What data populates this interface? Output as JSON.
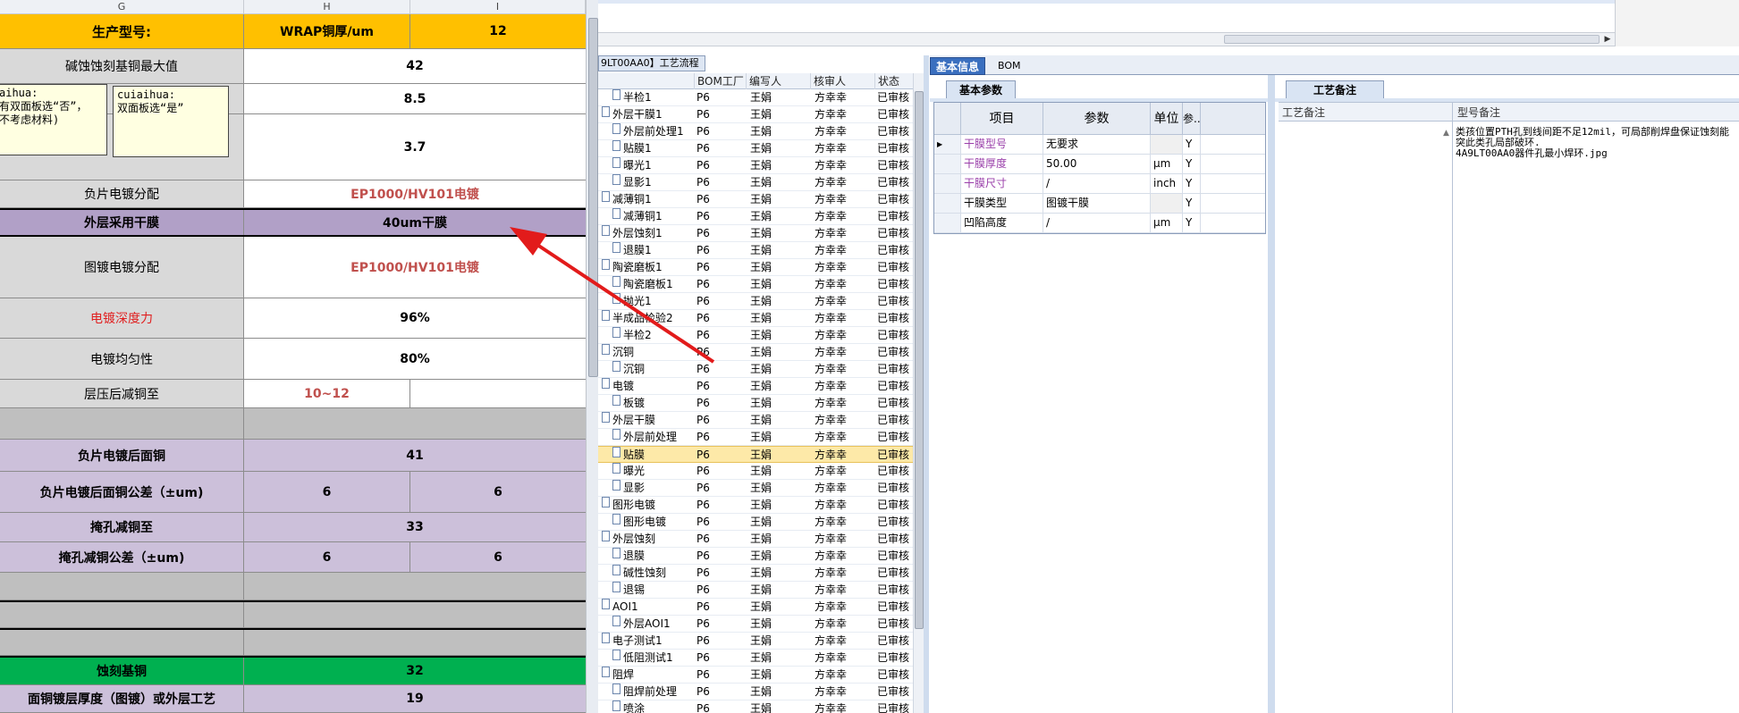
{
  "sheet": {
    "columns": [
      "G",
      "H",
      "I"
    ],
    "rows": [
      {
        "label": "生产型号:",
        "h": "WRAP铜厚/um",
        "i": "12"
      },
      {
        "label": "碱蚀蚀刻基铜最大值",
        "value": "42"
      },
      {
        "label": "",
        "value": "8.5"
      },
      {
        "label": "",
        "value": "3.7"
      },
      {
        "label": "负片电镀分配",
        "value": "EP1000/HV101电镀"
      },
      {
        "label": "外层采用干膜",
        "value": "40um干膜"
      },
      {
        "label": "图镀电镀分配",
        "value": "EP1000/HV101电镀"
      },
      {
        "label": "电镀深度力",
        "value": "96%"
      },
      {
        "label": "电镀均匀性",
        "value": "80%"
      },
      {
        "label": "层压后减铜至",
        "value": "10~12"
      },
      {
        "label": "",
        "value": ""
      },
      {
        "label": "负片电镀后面铜",
        "value": "41"
      },
      {
        "label": "负片电镀后面铜公差（±um)",
        "h": "6",
        "i": "6"
      },
      {
        "label": "掩孔减铜至",
        "value": "33"
      },
      {
        "label": "掩孔减铜公差（±um)",
        "h": "6",
        "i": "6"
      },
      {
        "label": "",
        "value": ""
      },
      {
        "label": "",
        "value": ""
      },
      {
        "label": "",
        "value": ""
      },
      {
        "label": "蚀刻基铜",
        "value": "32"
      },
      {
        "label": "面铜镀层厚度（图镀）或外层工艺",
        "value": "19"
      }
    ],
    "comments": [
      {
        "text": "aihua:\n有双面板选“否”，\n不考虑材料)"
      },
      {
        "text": "cuiaihua:\n双面板选“是”"
      }
    ]
  },
  "tree": {
    "tab_label": "9LT00AA0】工艺流程",
    "headers": [
      "BOM工厂",
      "编写人",
      "核审人",
      "状态"
    ],
    "rows": [
      {
        "name": "半检1",
        "indent": 1,
        "factory": "P6",
        "writer": "王娟",
        "reviewer": "方幸幸",
        "status": "已审核"
      },
      {
        "name": "外层干膜1",
        "indent": 0,
        "factory": "P6",
        "writer": "王娟",
        "reviewer": "方幸幸",
        "status": "已审核"
      },
      {
        "name": "外层前处理1",
        "indent": 1,
        "factory": "P6",
        "writer": "王娟",
        "reviewer": "方幸幸",
        "status": "已审核"
      },
      {
        "name": "贴膜1",
        "indent": 1,
        "factory": "P6",
        "writer": "王娟",
        "reviewer": "方幸幸",
        "status": "已审核"
      },
      {
        "name": "曝光1",
        "indent": 1,
        "factory": "P6",
        "writer": "王娟",
        "reviewer": "方幸幸",
        "status": "已审核"
      },
      {
        "name": "显影1",
        "indent": 1,
        "factory": "P6",
        "writer": "王娟",
        "reviewer": "方幸幸",
        "status": "已审核"
      },
      {
        "name": "减薄铜1",
        "indent": 0,
        "factory": "P6",
        "writer": "王娟",
        "reviewer": "方幸幸",
        "status": "已审核"
      },
      {
        "name": "减薄铜1",
        "indent": 1,
        "factory": "P6",
        "writer": "王娟",
        "reviewer": "方幸幸",
        "status": "已审核"
      },
      {
        "name": "外层蚀刻1",
        "indent": 0,
        "factory": "P6",
        "writer": "王娟",
        "reviewer": "方幸幸",
        "status": "已审核"
      },
      {
        "name": "退膜1",
        "indent": 1,
        "factory": "P6",
        "writer": "王娟",
        "reviewer": "方幸幸",
        "status": "已审核"
      },
      {
        "name": "陶瓷磨板1",
        "indent": 0,
        "factory": "P6",
        "writer": "王娟",
        "reviewer": "方幸幸",
        "status": "已审核"
      },
      {
        "name": "陶瓷磨板1",
        "indent": 1,
        "factory": "P6",
        "writer": "王娟",
        "reviewer": "方幸幸",
        "status": "已审核"
      },
      {
        "name": "抛光1",
        "indent": 1,
        "factory": "P6",
        "writer": "王娟",
        "reviewer": "方幸幸",
        "status": "已审核"
      },
      {
        "name": "半成品检验2",
        "indent": 0,
        "factory": "P6",
        "writer": "王娟",
        "reviewer": "方幸幸",
        "status": "已审核"
      },
      {
        "name": "半检2",
        "indent": 1,
        "factory": "P6",
        "writer": "王娟",
        "reviewer": "方幸幸",
        "status": "已审核"
      },
      {
        "name": "沉铜",
        "indent": 0,
        "factory": "P6",
        "writer": "王娟",
        "reviewer": "方幸幸",
        "status": "已审核"
      },
      {
        "name": "沉铜",
        "indent": 1,
        "factory": "P6",
        "writer": "王娟",
        "reviewer": "方幸幸",
        "status": "已审核"
      },
      {
        "name": "电镀",
        "indent": 0,
        "factory": "P6",
        "writer": "王娟",
        "reviewer": "方幸幸",
        "status": "已审核"
      },
      {
        "name": "板镀",
        "indent": 1,
        "factory": "P6",
        "writer": "王娟",
        "reviewer": "方幸幸",
        "status": "已审核"
      },
      {
        "name": "外层干膜",
        "indent": 0,
        "factory": "P6",
        "writer": "王娟",
        "reviewer": "方幸幸",
        "status": "已审核"
      },
      {
        "name": "外层前处理",
        "indent": 1,
        "factory": "P6",
        "writer": "王娟",
        "reviewer": "方幸幸",
        "status": "已审核"
      },
      {
        "name": "贴膜",
        "indent": 1,
        "factory": "P6",
        "writer": "王娟",
        "reviewer": "方幸幸",
        "status": "已审核",
        "selected": true
      },
      {
        "name": "曝光",
        "indent": 1,
        "factory": "P6",
        "writer": "王娟",
        "reviewer": "方幸幸",
        "status": "已审核"
      },
      {
        "name": "显影",
        "indent": 1,
        "factory": "P6",
        "writer": "王娟",
        "reviewer": "方幸幸",
        "status": "已审核"
      },
      {
        "name": "图形电镀",
        "indent": 0,
        "factory": "P6",
        "writer": "王娟",
        "reviewer": "方幸幸",
        "status": "已审核"
      },
      {
        "name": "图形电镀",
        "indent": 1,
        "factory": "P6",
        "writer": "王娟",
        "reviewer": "方幸幸",
        "status": "已审核"
      },
      {
        "name": "外层蚀刻",
        "indent": 0,
        "factory": "P6",
        "writer": "王娟",
        "reviewer": "方幸幸",
        "status": "已审核"
      },
      {
        "name": "退膜",
        "indent": 1,
        "factory": "P6",
        "writer": "王娟",
        "reviewer": "方幸幸",
        "status": "已审核"
      },
      {
        "name": "碱性蚀刻",
        "indent": 1,
        "factory": "P6",
        "writer": "王娟",
        "reviewer": "方幸幸",
        "status": "已审核"
      },
      {
        "name": "退锡",
        "indent": 1,
        "factory": "P6",
        "writer": "王娟",
        "reviewer": "方幸幸",
        "status": "已审核"
      },
      {
        "name": "AOI1",
        "indent": 0,
        "factory": "P6",
        "writer": "王娟",
        "reviewer": "方幸幸",
        "status": "已审核"
      },
      {
        "name": "外层AOI1",
        "indent": 1,
        "factory": "P6",
        "writer": "王娟",
        "reviewer": "方幸幸",
        "status": "已审核"
      },
      {
        "name": "电子测试1",
        "indent": 0,
        "factory": "P6",
        "writer": "王娟",
        "reviewer": "方幸幸",
        "status": "已审核"
      },
      {
        "name": "低阻测试1",
        "indent": 1,
        "factory": "P6",
        "writer": "王娟",
        "reviewer": "方幸幸",
        "status": "已审核"
      },
      {
        "name": "阻焊",
        "indent": 0,
        "factory": "P6",
        "writer": "王娟",
        "reviewer": "方幸幸",
        "status": "已审核"
      },
      {
        "name": "阻焊前处理",
        "indent": 1,
        "factory": "P6",
        "writer": "王娟",
        "reviewer": "方幸幸",
        "status": "已审核"
      },
      {
        "name": "喷涂",
        "indent": 1,
        "factory": "P6",
        "writer": "王娟",
        "reviewer": "方幸幸",
        "status": "已审核"
      }
    ]
  },
  "info": {
    "tabs": [
      "基本信息",
      "BOM"
    ],
    "subtab": "基本参数",
    "headers": [
      "项目",
      "参数",
      "单位",
      "参..."
    ],
    "rows": [
      {
        "item": "干膜型号",
        "param": "无要求",
        "unit": "",
        "flag": "Y"
      },
      {
        "item": "干膜厚度",
        "param": "50.00",
        "unit": "μm",
        "flag": "Y"
      },
      {
        "item": "干膜尺寸",
        "param": "/",
        "unit": "inch",
        "flag": "Y"
      },
      {
        "item": "干膜类型",
        "param": "图镀干膜",
        "unit": "",
        "flag": "Y"
      },
      {
        "item": "凹陷高度",
        "param": "/",
        "unit": "μm",
        "flag": "Y"
      }
    ]
  },
  "notes": {
    "tab": "工艺备注",
    "col1": "工艺备注",
    "col2": "型号备注",
    "text_lines": [
      "类孩位置PTH孔到线间距不足12mil，可局部削焊盘保证蚀刻能",
      "突此类孔局部破环.",
      "4A9LT00AA0器件孔最小焊环.jpg"
    ]
  },
  "colors": {
    "header_orange": "#ffc000",
    "purple_row": "#b1a0c7",
    "lavender_row": "#ccc0da",
    "green_row": "#00b050",
    "gray_label": "#d9d9d9",
    "arrow_red": "#e21b1b",
    "tab_blue": "#3a6fbf"
  }
}
